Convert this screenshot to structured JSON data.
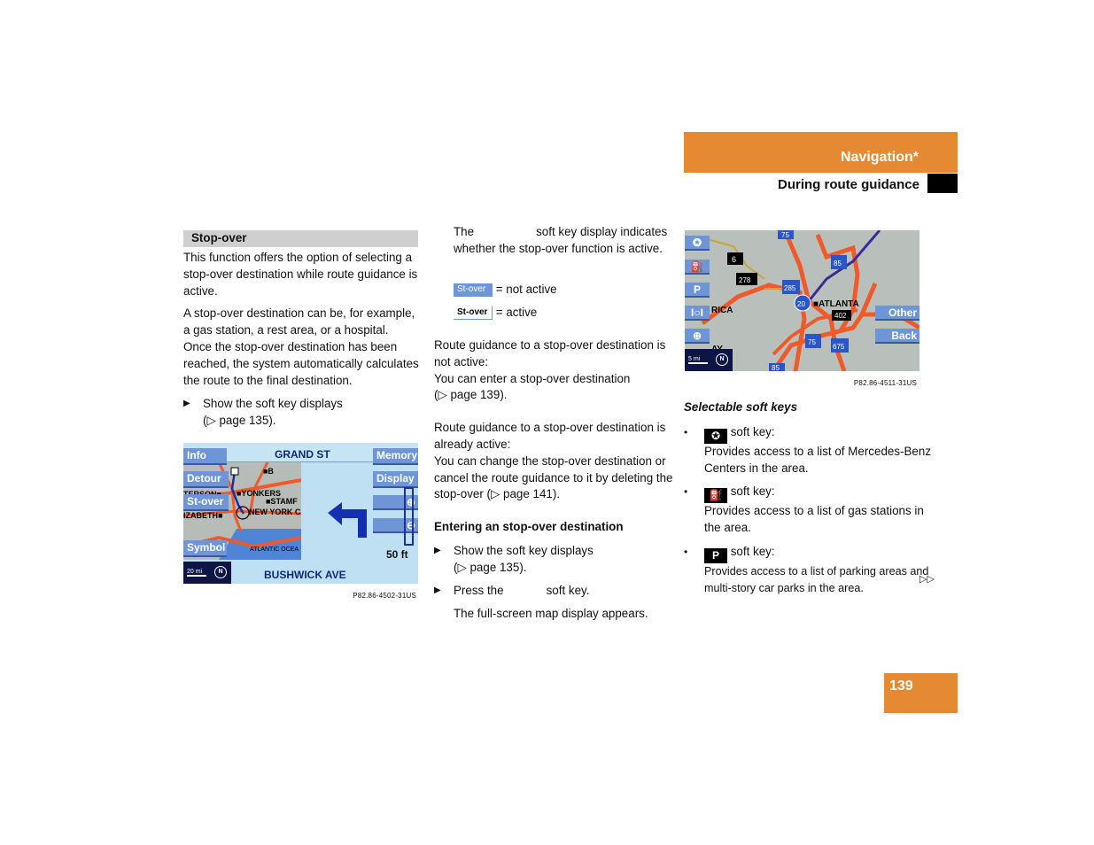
{
  "header": {
    "chapter": "Navigation*",
    "section": "During route guidance"
  },
  "colors": {
    "accent_orange": "#e58a33",
    "softkey_blue": "#6e95d8",
    "section_gray": "#cfcfcf"
  },
  "column1": {
    "section_title": "Stop-over",
    "para1": "This function offers the option of selecting a stop-over destination while route guidance is active.",
    "para2": "A stop-over destination can be, for example, a gas station, a rest area, or a hospital. Once the stop-over destination has been reached, the system automatically calculates the route to the final destination.",
    "step1": "Show the soft key displays",
    "step1_ref": "(▷ page 135).",
    "screen": {
      "top_street": "GRAND ST",
      "bottom_street": "BUSHWICK AVE",
      "softkeys_left": [
        "Info",
        "Detour",
        "St-over",
        "Symbol"
      ],
      "softkeys_right": [
        "Memory",
        "Display"
      ],
      "zoom_in_icon": "zoom-in-icon",
      "zoom_out_icon": "zoom-out-icon",
      "distance": "50 ft",
      "scale": "20 mi",
      "north": "N",
      "map_labels": [
        "B",
        "STAMF",
        "TERSON",
        "YONKERS",
        "NEW YORK CI",
        "IZABETH",
        "ATLANTIC OCEA"
      ],
      "caption": "P82.86-4502-31US"
    }
  },
  "column2": {
    "intro_a": "The",
    "intro_b": "soft key display indicates whether the stop-over function is active.",
    "badge_label": "St-over",
    "not_active": "= not active",
    "active": "= active",
    "para_not_active_1": "Route guidance to a stop-over destination is not active:",
    "para_not_active_2": "You can enter a stop-over destination",
    "para_not_active_ref": "(▷ page 139).",
    "para_active_1": "Route guidance to a stop-over destination is already active:",
    "para_active_2": "You can change the stop-over destination or cancel the route guidance to it by deleting the stop-over (▷ page 141).",
    "subheading": "Entering an stop-over destination",
    "step1": "Show the soft key displays",
    "step1_ref": "(▷ page 135).",
    "step2_a": "Press the",
    "step2_b": "soft key.",
    "result": "The full-screen map display appears."
  },
  "column3": {
    "screen": {
      "softkeys_left_icons": [
        "mercedes-star-icon",
        "gas-pump-icon",
        "parking-icon",
        "poi-icon",
        "hospital-icon"
      ],
      "softkeys_right": [
        "Other",
        "Back"
      ],
      "map_labels": [
        "ATLANTA",
        "VILLA RICA",
        "FAIRPLAY"
      ],
      "route_shields": [
        "75",
        "6",
        "278",
        "285",
        "85",
        "20",
        "402",
        "75",
        "675",
        "85"
      ],
      "scale": "5 mi",
      "north": "N",
      "caption": "P82.86-4511-31US"
    },
    "subheading": "Selectable soft keys",
    "items": [
      {
        "icon": "mercedes-star-icon",
        "label": "soft key:",
        "desc": "Provides access to a list of Mercedes-Benz Centers in the area."
      },
      {
        "icon": "gas-pump-icon",
        "label": "soft key:",
        "desc": "Provides access to a list of gas stations in the area."
      },
      {
        "icon": "parking-icon",
        "label": "soft key:",
        "desc": "Provides access to a list of parking areas and multi-story car parks in the area."
      }
    ],
    "continue_mark": "▷▷"
  },
  "page_number": "139"
}
